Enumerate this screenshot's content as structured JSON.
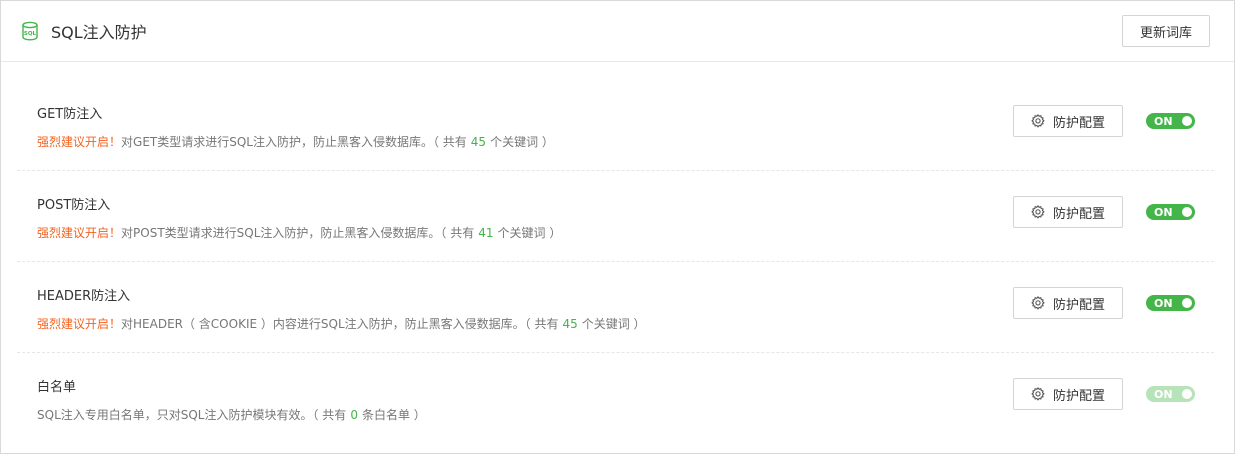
{
  "header": {
    "icon": "database-sql-icon",
    "title": "SQL注入防护",
    "update_label": "更新词库"
  },
  "colors": {
    "accent_green": "#44b549",
    "warning_orange": "#f3631f",
    "faded_green": "#b7e3b9"
  },
  "rows": [
    {
      "title": "GET防注入",
      "warn": "强烈建议开启！",
      "desc_pre": "对GET类型请求进行SQL注入防护，防止黑客入侵数据库。（ 共有",
      "count": "45",
      "desc_post": "个关键词 ）",
      "config_label": "防护配置",
      "toggle_label": "ON",
      "toggle_on": true
    },
    {
      "title": "POST防注入",
      "warn": "强烈建议开启！",
      "desc_pre": "对POST类型请求进行SQL注入防护，防止黑客入侵数据库。（ 共有",
      "count": "41",
      "desc_post": "个关键词 ）",
      "config_label": "防护配置",
      "toggle_label": "ON",
      "toggle_on": true
    },
    {
      "title": "HEADER防注入",
      "warn": "强烈建议开启！",
      "desc_pre": "对HEADER（ 含COOKIE ）内容进行SQL注入防护，防止黑客入侵数据库。（ 共有",
      "count": "45",
      "desc_post": "个关键词 ）",
      "config_label": "防护配置",
      "toggle_label": "ON",
      "toggle_on": true
    },
    {
      "title": "白名单",
      "warn": "",
      "desc_pre": "SQL注入专用白名单，只对SQL注入防护模块有效。（ 共有",
      "count": "0",
      "desc_post": "条白名单 ）",
      "config_label": "防护配置",
      "toggle_label": "ON",
      "toggle_on": true
    }
  ]
}
